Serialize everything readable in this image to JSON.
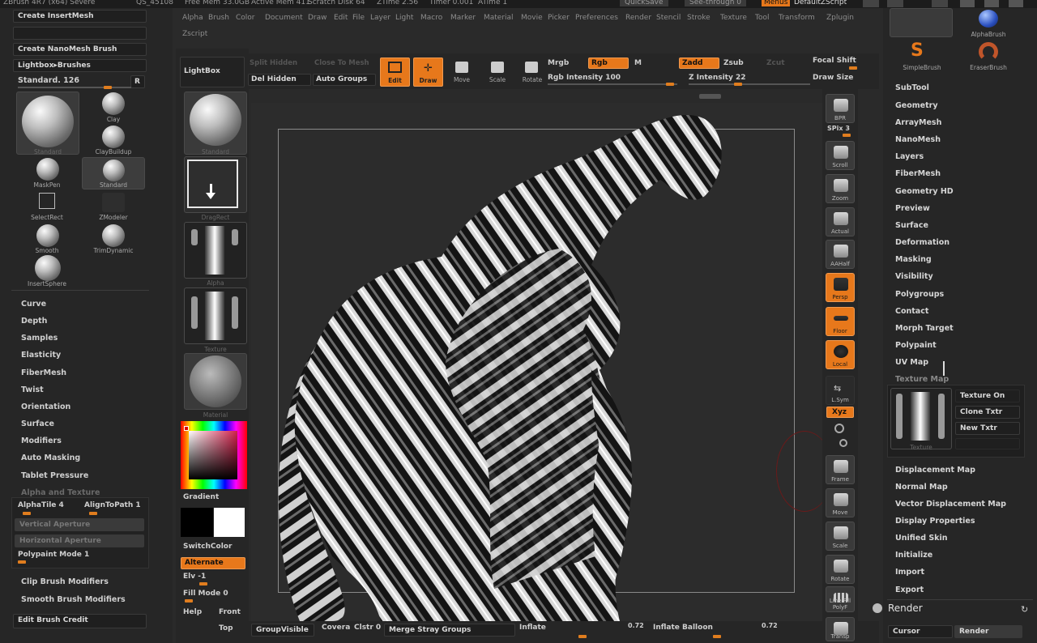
{
  "topbar": {
    "items": [
      "ZBrush 4R7 (x64) Severe",
      "QS_45108",
      "Free Mem 33.0GB",
      "Active Mem 411",
      "Scratch Disk 64",
      "ZTime 2.56",
      "Timer 0.001",
      "ATime 1"
    ],
    "quicksave": "QuickSave",
    "seethrough": "See-through 0",
    "menus": "Menus",
    "script": "DefaultZScript"
  },
  "menubar": [
    "Alpha",
    "Brush",
    "Color",
    "Document",
    "Draw",
    "Edit",
    "File",
    "Layer",
    "Light",
    "Macro",
    "Marker",
    "Material",
    "Movie",
    "Picker",
    "Preferences",
    "Render",
    "Stencil",
    "Stroke",
    "Texture",
    "Tool",
    "Transform",
    "Zplugin",
    "Zscript"
  ],
  "left": {
    "create_insertmesh": "Create InsertMesh",
    "create_nanomesh": "Create NanoMesh Brush",
    "lightbox_brushes": "Lightbox▸Brushes",
    "brush_name": "Standard. 126",
    "r_label": "R",
    "brushes": [
      "Standard",
      "Clay",
      "ClayBuildup",
      "MaskPen",
      "Standard",
      "SelectRect",
      "ZModeler",
      "Smooth",
      "TrimDynamic",
      "InsertSphere"
    ],
    "sections": [
      "Curve",
      "Depth",
      "Samples",
      "Elasticity",
      "FiberMesh",
      "Twist",
      "Orientation",
      "Surface",
      "Modifiers",
      "Auto Masking",
      "Tablet Pressure",
      "Alpha and Texture"
    ],
    "alphatile": "AlphaTile 4",
    "aligntopath": "AlignToPath 1",
    "vertical_aperture": "Vertical Aperture",
    "horizontal_aperture": "Horizontal Aperture",
    "polypaint_mode": "Polypaint Mode 1",
    "clip_brush": "Clip Brush Modifiers",
    "smooth_brush": "Smooth Brush Modifiers",
    "edit_credit": "Edit Brush Credit"
  },
  "shelf": {
    "lightbox": "LightBox",
    "labels": [
      "Standard",
      "DragRect",
      "Alpha",
      "Texture",
      "Material"
    ],
    "gradient": "Gradient",
    "switchcolor": "SwitchColor",
    "alternate": "Alternate",
    "elv": "Elv -1",
    "fillmode": "Fill Mode 0",
    "help": "Help",
    "front": "Front",
    "top": "Top"
  },
  "toolbar": {
    "del_hidden": "Del Hidden",
    "auto_groups": "Auto Groups",
    "edit": "Edit",
    "draw": "Draw",
    "move": "Move",
    "scale": "Scale",
    "rotate": "Rotate",
    "mrgb": "Mrgb",
    "rgb": "Rgb",
    "m": "M",
    "rgb_intensity": "Rgb Intensity 100",
    "zadd": "Zadd",
    "zsub": "Zsub",
    "z_intensity": "Z Intensity 22",
    "focal_shift": "Focal Shift",
    "draw_size": "Draw Size"
  },
  "bottombar": {
    "groupvisible": "GroupVisible",
    "covera": "Covera",
    "clstr": "Clstr 0",
    "merge_stray": "Merge Stray Groups",
    "inflate": "Inflate",
    "inflate_val": "0.72",
    "inflate_balloon": "Inflate Balloon",
    "balloon_val": "0.72"
  },
  "viewtools": [
    "BPR",
    "SPix 3",
    "Scroll",
    "Zoom",
    "Actual",
    "AAHalf",
    "Persp",
    "Floor",
    "Local",
    "L.Sym",
    "Xyz",
    "Frame",
    "Move",
    "Scale",
    "Rotate",
    "Line Fill PolyF",
    "Transp"
  ],
  "right": {
    "top_brushes": [
      "AlphaBrush",
      "SimpleBrush",
      "EraserBrush"
    ],
    "items": [
      "SubTool",
      "Geometry",
      "ArrayMesh",
      "NanoMesh",
      "Layers",
      "FiberMesh",
      "Geometry HD",
      "Preview",
      "Surface",
      "Deformation",
      "Masking",
      "Visibility",
      "Polygroups",
      "Contact",
      "Morph Target",
      "Polypaint",
      "UV Map",
      "Texture Map"
    ],
    "texture_on": "Texture On",
    "clone_txtr": "Clone Txtr",
    "new_txtr": "New Txtr",
    "tex_label": "Texture",
    "items2": [
      "Displacement Map",
      "Normal Map",
      "Vector Displacement Map",
      "Display Properties",
      "Unified Skin",
      "Initialize",
      "Import",
      "Export"
    ],
    "render_title": "Render",
    "cursor": "Cursor",
    "render": "Render"
  },
  "colors": {
    "accent": "#e7781b",
    "panel": "#262626",
    "canvas": "#2c2c2c"
  }
}
